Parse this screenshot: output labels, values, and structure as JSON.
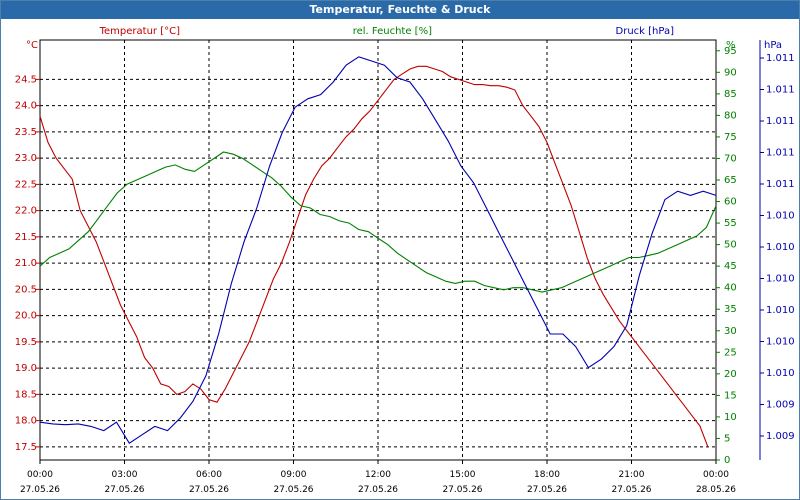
{
  "window": {
    "title": "Temperatur, Feuchte & Druck"
  },
  "chart_data": {
    "type": "line",
    "title": "Temperatur, Feuchte & Druck",
    "colors": {
      "temperature": "#c00000",
      "humidity": "#008000",
      "pressure": "#0000b0"
    },
    "x": [
      0,
      0.25,
      0.5,
      0.75,
      1,
      1.25,
      1.5,
      1.75,
      2,
      2.25,
      2.5,
      2.75,
      3,
      3.25,
      3.5,
      3.75,
      4,
      4.25,
      4.5,
      4.75,
      5,
      5.25,
      5.5,
      5.75,
      6,
      6.25,
      6.5,
      6.75,
      7,
      7.25,
      7.5,
      7.75,
      8,
      8.25,
      8.5,
      8.75,
      9,
      9.25,
      9.5,
      9.75,
      10,
      10.25,
      10.5,
      10.75,
      11,
      11.25,
      11.5,
      11.75,
      12,
      12.25,
      12.5,
      12.75,
      13,
      13.25,
      13.5,
      13.75,
      14,
      14.25,
      14.5,
      14.75,
      15,
      15.25,
      15.5,
      15.75,
      16,
      16.25,
      16.5,
      16.75,
      17,
      17.25,
      17.5,
      17.75,
      18,
      18.25,
      18.5,
      18.75,
      19,
      19.25,
      19.5,
      19.75,
      20,
      20.25,
      20.5,
      20.75,
      21,
      21.25,
      21.5,
      21.75,
      22,
      22.25,
      22.5,
      22.75,
      23,
      23.25,
      23.5,
      23.75,
      24
    ],
    "x_ticks": [
      {
        "time": "00:00",
        "date": "27.05.26"
      },
      {
        "time": "03:00",
        "date": "27.05.26"
      },
      {
        "time": "06:00",
        "date": "27.05.26"
      },
      {
        "time": "09:00",
        "date": "27.05.26"
      },
      {
        "time": "12:00",
        "date": "27.05.26"
      },
      {
        "time": "15:00",
        "date": "27.05.26"
      },
      {
        "time": "18:00",
        "date": "27.05.26"
      },
      {
        "time": "21:00",
        "date": "27.05.26"
      },
      {
        "time": "00:00",
        "date": "28.05.26"
      }
    ],
    "series": [
      {
        "name": "Temperatur [°C]",
        "axis": "left",
        "values": [
          23.8,
          23.3,
          23.0,
          22.8,
          22.6,
          22.0,
          21.7,
          21.4,
          21.0,
          20.6,
          20.2,
          19.9,
          19.6,
          19.2,
          19.0,
          18.7,
          18.65,
          18.5,
          18.55,
          18.7,
          18.6,
          18.4,
          18.35,
          18.6,
          18.9,
          19.2,
          19.5,
          19.9,
          20.3,
          20.7,
          21.0,
          21.4,
          21.85,
          22.3,
          22.6,
          22.85,
          23.0,
          23.2,
          23.4,
          23.55,
          23.75,
          23.9,
          24.1,
          24.3,
          24.5,
          24.6,
          24.7,
          24.75,
          24.75,
          24.7,
          24.65,
          24.55,
          24.5,
          24.45,
          24.4,
          24.4,
          24.38,
          24.38,
          24.35,
          24.3,
          24.0,
          23.8,
          23.6,
          23.3,
          22.9,
          22.5,
          22.1,
          21.6,
          21.1,
          20.7,
          20.4,
          20.15,
          19.9,
          19.7,
          19.5,
          19.3,
          19.1,
          18.9,
          18.7,
          18.5,
          18.3,
          18.1,
          17.9,
          17.5
        ],
        "x_from": 0,
        "x_step": 0.2857
      },
      {
        "name": "rel. Feuchte [%]",
        "axis": "right",
        "values": [
          45,
          47,
          48,
          49,
          51,
          53,
          56,
          59,
          62,
          64,
          65,
          66,
          67,
          68,
          68.5,
          67.5,
          67,
          68.5,
          70,
          71.5,
          71,
          70,
          68.5,
          67,
          65.5,
          63.5,
          61,
          59,
          58.5,
          57,
          56.5,
          55.5,
          55,
          53.5,
          53,
          51.5,
          50,
          48,
          46.5,
          45,
          43.5,
          42.5,
          41.5,
          41,
          41.5,
          41.5,
          40.5,
          40,
          39.5,
          40,
          40,
          39.5,
          39,
          39.5,
          40,
          41,
          42,
          43,
          44,
          45,
          46,
          47,
          47,
          47.5,
          48,
          49,
          50,
          51,
          52,
          54,
          59
        ],
        "x_from": 0,
        "x_step": 0.3429
      },
      {
        "name": "Druck [hPa]",
        "axis": "right2",
        "values": [
          1009.095,
          1009.093,
          1009.092,
          1009.093,
          1009.09,
          1009.085,
          1009.095,
          1009.07,
          1009.08,
          1009.09,
          1009.085,
          1009.1,
          1009.12,
          1009.15,
          1009.2,
          1009.26,
          1009.31,
          1009.35,
          1009.4,
          1009.44,
          1009.47,
          1009.48,
          1009.485,
          1009.5,
          1009.52,
          1009.53,
          1009.525,
          1009.52,
          1009.505,
          1009.5,
          1009.48,
          1009.455,
          1009.43,
          1009.4,
          1009.38,
          1009.35,
          1009.32,
          1009.29,
          1009.26,
          1009.23,
          1009.2,
          1009.2,
          1009.185,
          1009.16,
          1009.17,
          1009.185,
          1009.21,
          1009.27,
          1009.32,
          1009.36,
          1009.37,
          1009.365,
          1009.37,
          1009.365
        ],
        "x_from": 0,
        "x_step": 0.4528
      }
    ],
    "y_left": {
      "unit": "°C",
      "min": 17.25,
      "max": 25.25,
      "ticks": [
        "17.5",
        "18.0",
        "18.5",
        "19.0",
        "19.5",
        "20.0",
        "20.5",
        "21.0",
        "21.5",
        "22.0",
        "22.5",
        "23.0",
        "23.5",
        "24.0",
        "24.5"
      ]
    },
    "y_right": {
      "unit": "%",
      "min": 0,
      "max": 97.5,
      "ticks": [
        "0",
        "5",
        "10",
        "15",
        "20",
        "25",
        "30",
        "35",
        "40",
        "45",
        "50",
        "55",
        "60",
        "65",
        "70",
        "75",
        "80",
        "85",
        "90",
        "95"
      ]
    },
    "y_right2": {
      "unit": "hPa",
      "min": 1009.05,
      "max": 1009.55,
      "ticks": [
        "1.009",
        "1.009",
        "1.010",
        "1.010",
        "1.010",
        "1.010",
        "1.010",
        "1.010",
        "1.011",
        "1.011",
        "1.011",
        "1.011",
        "1.011"
      ]
    },
    "legend": {
      "temperature": "Temperatur [°C]",
      "humidity": "rel. Feuchte [%]",
      "pressure": "Druck [hPa]"
    },
    "grid": true
  }
}
